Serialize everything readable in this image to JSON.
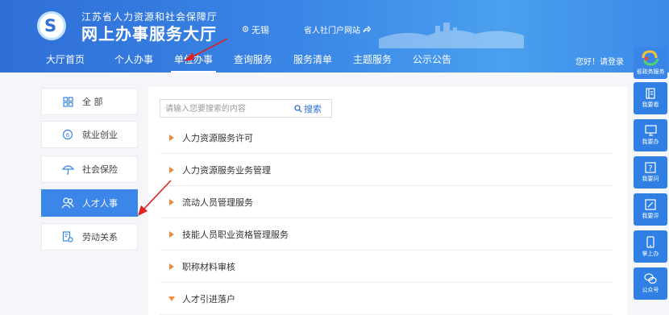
{
  "header": {
    "org_name": "江苏省人力资源和社会保障厅",
    "hall_name": "网上办事服务大厅",
    "city": "无锡",
    "portal_link": "省人社门户网站",
    "login_text": "您好！请登录"
  },
  "nav": {
    "items": [
      {
        "label": "大厅首页"
      },
      {
        "label": "个人办事"
      },
      {
        "label": "单位办事"
      },
      {
        "label": "查询服务"
      },
      {
        "label": "服务清单"
      },
      {
        "label": "主题服务"
      },
      {
        "label": "公示公告"
      }
    ],
    "active": "单位办事"
  },
  "sidebar": {
    "items": [
      {
        "label": "全 部",
        "icon": "grid-icon"
      },
      {
        "label": "就业创业",
        "icon": "badge-icon"
      },
      {
        "label": "社会保险",
        "icon": "umbrella-icon"
      },
      {
        "label": "人才人事",
        "icon": "people-icon"
      },
      {
        "label": "劳动关系",
        "icon": "document-icon"
      }
    ],
    "active": "人才人事"
  },
  "search": {
    "placeholder": "请输入您要搜索的内容",
    "button_label": "搜索"
  },
  "list": {
    "items": [
      {
        "label": "人力资源服务许可",
        "expanded": false
      },
      {
        "label": "人力资源服务业务管理",
        "expanded": false
      },
      {
        "label": "流动人员管理服务",
        "expanded": false
      },
      {
        "label": "技能人员职业资格管理服务",
        "expanded": false
      },
      {
        "label": "职称材料审核",
        "expanded": false
      },
      {
        "label": "人才引进落户",
        "expanded": true
      }
    ]
  },
  "right_bar": {
    "items": [
      {
        "label": "省政务服务",
        "icon": "gov-service-logo-icon"
      },
      {
        "label": "我要看",
        "icon": "book-icon"
      },
      {
        "label": "我要办",
        "icon": "monitor-icon"
      },
      {
        "label": "我要问",
        "icon": "question-icon"
      },
      {
        "label": "我要评",
        "icon": "edit-icon"
      },
      {
        "label": "掌上办",
        "icon": "phone-icon"
      },
      {
        "label": "公众号",
        "icon": "wechat-icon"
      }
    ]
  },
  "colors": {
    "brand": "#2f6fd6",
    "accent_orange": "#f08a3a",
    "annotation_red": "#e02020"
  }
}
